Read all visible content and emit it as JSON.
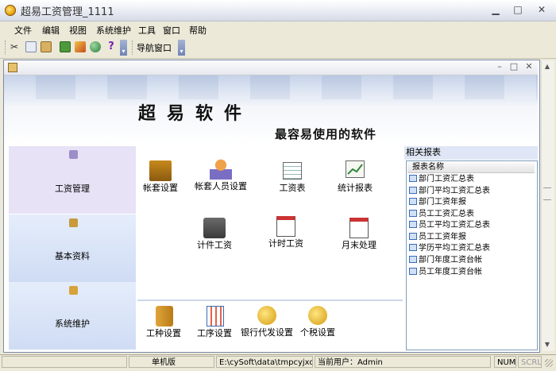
{
  "window": {
    "title": "超易工资管理_1111"
  },
  "menu": [
    "文件",
    "编辑",
    "视图",
    "系统维护",
    "工具",
    "窗口",
    "帮助"
  ],
  "toolbar": {
    "nav_window": "导航窗口"
  },
  "banner": {
    "title": "超易软件",
    "slogan": "最容易使用的软件"
  },
  "leftnav": [
    "工资管理",
    "基本资料",
    "系统维护"
  ],
  "functions": [
    "帐套设置",
    "帐套人员设置",
    "工资表",
    "统计报表",
    "计件工资",
    "计时工资",
    "月末处理"
  ],
  "bottom_functions": [
    "工种设置",
    "工序设置",
    "银行代发设置",
    "个税设置"
  ],
  "reports": {
    "header": "相关报表",
    "column": "报表名称",
    "items": [
      "部门工资汇总表",
      "部门平均工资汇总表",
      "部门工资年报",
      "员工工资汇总表",
      "员工平均工资汇总表",
      "员工工资年报",
      "学历平均工资汇总表",
      "部门年度工资台帐",
      "员工年度工资台帐"
    ]
  },
  "status": {
    "mode": "单机版",
    "path": "E:\\cySoft\\data\\tmpcyjxc.sys",
    "user": "当前用户：Admin",
    "num": "NUM",
    "scrl": "SCRL"
  },
  "colors": {
    "accent": "#2f5cb0",
    "panel": "#d9e4f8"
  }
}
